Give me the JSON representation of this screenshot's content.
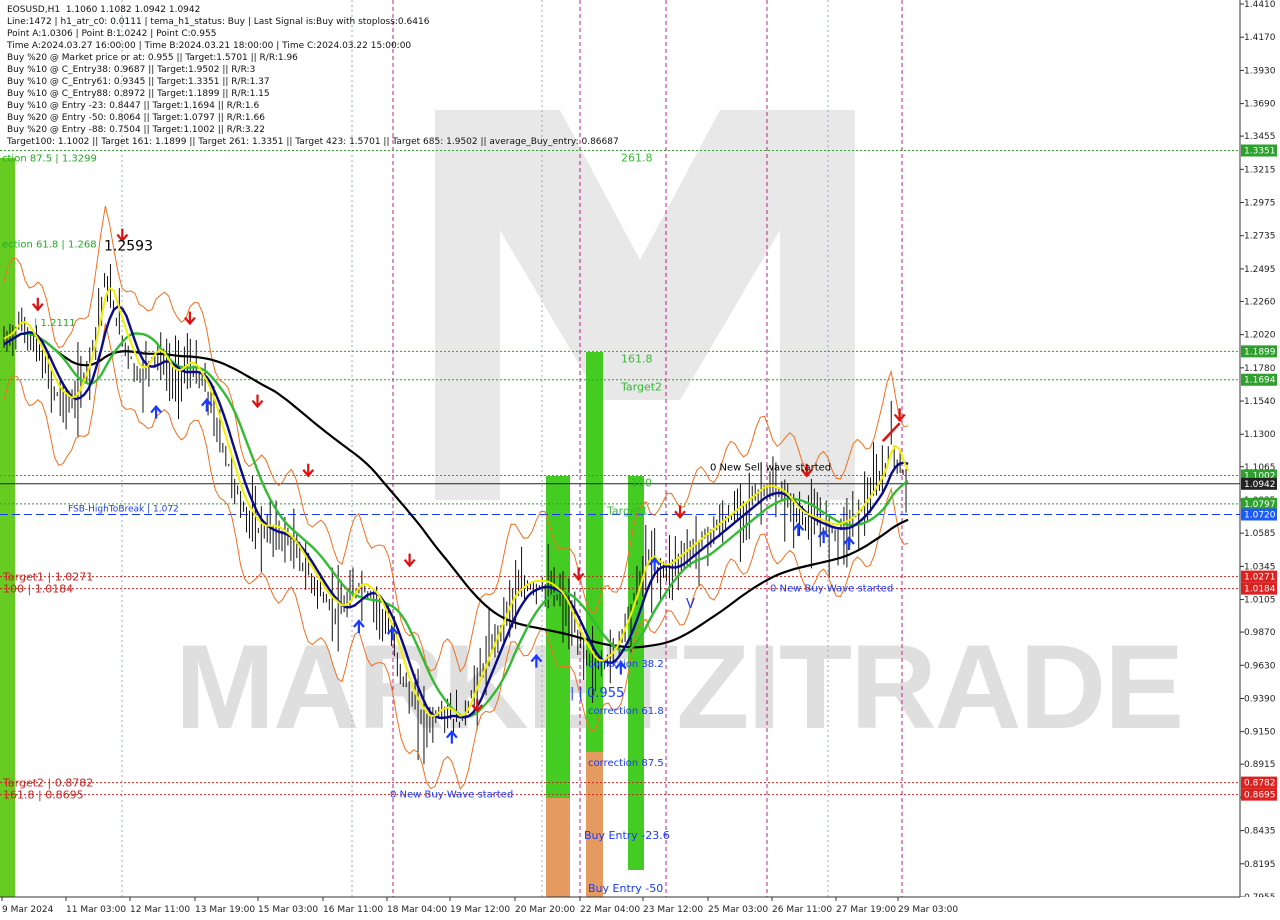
{
  "header": {
    "symbol": "EOSUSD,H1",
    "ohlc": "1.1060 1.1082 1.0942 1.0942",
    "lines": [
      "Line:1472 | h1_atr_c0: 0.0111 | tema_h1_status: Buy | Last Signal is:Buy with stoploss:0.6416",
      "Point A:1.0306 | Point B:1.0242 | Point C:0.955",
      "Time A:2024.03.27 16:00:00 | Time B:2024.03.21 18:00:00 | Time C:2024.03.22 15:00:00",
      "Buy %20 @ Market price or at: 0.955 || Target:1.5701 || R/R:1.96",
      "Buy %10 @ C_Entry38: 0.9687 || Target:1.9502 || R/R:3",
      "Buy %10 @ C_Entry61: 0.9345 || Target:1.3351 || R/R:1.37",
      "Buy %10 @ C_Entry88: 0.8972 || Target:1.1899 || R/R:1.15",
      "Buy %10 @ Entry -23: 0.8447 || Target:1.1694 || R/R:1.6",
      "Buy %20 @ Entry -50: 0.8064 || Target:1.0797 || R/R:1.66",
      "Buy %20 @ Entry -88: 0.7504 || Target:1.1002 || R/R:3.22",
      "Target100: 1.1002 || Target 161: 1.1899 || Target 261: 1.3351 || Target 423: 1.5701 || Target 685: 1.9502 || average_Buy_entry: 0.86687"
    ]
  },
  "chart_data": {
    "type": "candlestick",
    "symbol": "EOSUSD",
    "timeframe": "H1",
    "ylim": [
      0.7955,
      1.441
    ],
    "yticks": [
      "1.4410",
      "1.4170",
      "1.3930",
      "1.3690",
      "1.3455",
      "1.3215",
      "1.2975",
      "1.2735",
      "1.2495",
      "1.2260",
      "1.2020",
      "1.1780",
      "1.1540",
      "1.1300",
      "1.1065",
      "1.0825",
      "1.0585",
      "1.0345",
      "1.0105",
      "0.9870",
      "0.9630",
      "0.9390",
      "0.9150",
      "0.8915",
      "0.8675",
      "0.8435",
      "0.8195",
      "0.7955"
    ],
    "xticks": [
      "9 Mar 2024",
      "11 Mar 03:00",
      "12 Mar 11:00",
      "13 Mar 19:00",
      "15 Mar 03:00",
      "16 Mar 11:00",
      "18 Mar 04:00",
      "19 Mar 12:00",
      "20 Mar 20:00",
      "22 Mar 04:00",
      "23 Mar 12:00",
      "25 Mar 03:00",
      "26 Mar 11:00",
      "27 Mar 19:00",
      "29 Mar 03:00"
    ],
    "close_path": [
      [
        0,
        1.195
      ],
      [
        2,
        1.21
      ],
      [
        4,
        1.19
      ],
      [
        6,
        1.16
      ],
      [
        8,
        1.15
      ],
      [
        10,
        1.18
      ],
      [
        12,
        1.24
      ],
      [
        14,
        1.2
      ],
      [
        16,
        1.17
      ],
      [
        18,
        1.19
      ],
      [
        20,
        1.17
      ],
      [
        22,
        1.18
      ],
      [
        24,
        1.16
      ],
      [
        26,
        1.12
      ],
      [
        28,
        1.08
      ],
      [
        30,
        1.06
      ],
      [
        32,
        1.06
      ],
      [
        34,
        1.05
      ],
      [
        36,
        1.03
      ],
      [
        38,
        1.01
      ],
      [
        40,
        1.0
      ],
      [
        42,
        1.02
      ],
      [
        44,
        1.01
      ],
      [
        46,
        0.98
      ],
      [
        48,
        0.94
      ],
      [
        50,
        0.92
      ],
      [
        52,
        0.93
      ],
      [
        54,
        0.92
      ],
      [
        56,
        0.95
      ],
      [
        58,
        0.98
      ],
      [
        60,
        1.01
      ],
      [
        62,
        1.02
      ],
      [
        64,
        1.02
      ],
      [
        66,
        1.01
      ],
      [
        68,
        0.98
      ],
      [
        70,
        0.96
      ],
      [
        72,
        0.97
      ],
      [
        74,
        1.0
      ],
      [
        76,
        1.04
      ],
      [
        78,
        1.03
      ],
      [
        80,
        1.04
      ],
      [
        82,
        1.05
      ],
      [
        84,
        1.06
      ],
      [
        86,
        1.07
      ],
      [
        88,
        1.08
      ],
      [
        90,
        1.09
      ],
      [
        92,
        1.085
      ],
      [
        94,
        1.07
      ],
      [
        96,
        1.065
      ],
      [
        98,
        1.06
      ],
      [
        100,
        1.065
      ],
      [
        102,
        1.08
      ],
      [
        104,
        1.1
      ],
      [
        105,
        1.125
      ],
      [
        106,
        1.105
      ],
      [
        107,
        1.0942
      ]
    ],
    "levels": [
      {
        "value": 1.3351,
        "label": "1.3351",
        "text": "261.8",
        "color": "#2ea02e",
        "style": "dotted"
      },
      {
        "value": 1.1899,
        "label": "1.1899",
        "text": "161.8",
        "color": "#2ea02e",
        "style": "dotted"
      },
      {
        "value": 1.1694,
        "label": "1.1694",
        "text": "Target2",
        "color": "#2ea02e",
        "style": "dotted"
      },
      {
        "value": 1.1002,
        "label": "1.1002",
        "text": "100",
        "color": "#2ea02e",
        "style": "dotted"
      },
      {
        "value": 1.0942,
        "label": "1.0942",
        "text": "",
        "color": "#222222",
        "style": "solid"
      },
      {
        "value": 1.0797,
        "label": "1.0797",
        "text": "",
        "color": "#2ea02e",
        "style": "dotted"
      },
      {
        "value": 1.072,
        "label": "1.0720",
        "text": "Target1",
        "color": "#1a3aff",
        "style": "dashed"
      },
      {
        "value": 1.0271,
        "label": "1.0271",
        "text": "Target1 | 1.0271",
        "color": "#cc2222",
        "style": "dotted"
      },
      {
        "value": 1.0184,
        "label": "1.0184",
        "text": "100 | 1.0184",
        "color": "#cc2222",
        "style": "dotted"
      },
      {
        "value": 0.8782,
        "label": "0.8782",
        "text": "Target2 | 0.8782",
        "color": "#cc2222",
        "style": "dotted"
      },
      {
        "value": 0.8695,
        "label": "0.8695",
        "text": "161.8 | 0.8695",
        "color": "#cc2222",
        "style": "dotted"
      }
    ],
    "annotations": [
      {
        "text": "ction 87.5 | 1.3299",
        "color": "#22aa22"
      },
      {
        "text": "ection 61.8 | 1.268",
        "color": "#22aa22"
      },
      {
        "text": "1.2593",
        "color": "#000000"
      },
      {
        "text": "| 1.2111",
        "color": "#22aa22"
      },
      {
        "text": "FSB-HighToBreak | 1.072",
        "color": "#1a3aff"
      },
      {
        "text": "0 New Sell wave started",
        "color": "#000000"
      },
      {
        "text": "0 New Buy Wave started",
        "color": "#1a3aff"
      },
      {
        "text": "0 New Buy Wave started",
        "color": "#1a3aff"
      },
      {
        "text": "correction 38.2",
        "color": "#1a3aff"
      },
      {
        "text": "correction 61.8",
        "color": "#1a3aff"
      },
      {
        "text": "correction 87.5",
        "color": "#1a3aff"
      },
      {
        "text": "Buy Entry -23.6",
        "color": "#1a3aff"
      },
      {
        "text": "Buy Entry -50",
        "color": "#1a3aff"
      },
      {
        "text": "| | 0.955",
        "color": "#1a3aff"
      },
      {
        "text": "V",
        "color": "#1a3aff"
      }
    ],
    "watermark": "MARKETZITRADE"
  },
  "colors": {
    "price_axis_bg": "#2ea02e",
    "red_label": "#cc2222",
    "blue_label": "#1a3aff",
    "ma_black": "#000000",
    "ma_green": "#33bb33",
    "ma_navy": "#0a0a8a",
    "ma_yellow": "#f0f000"
  }
}
